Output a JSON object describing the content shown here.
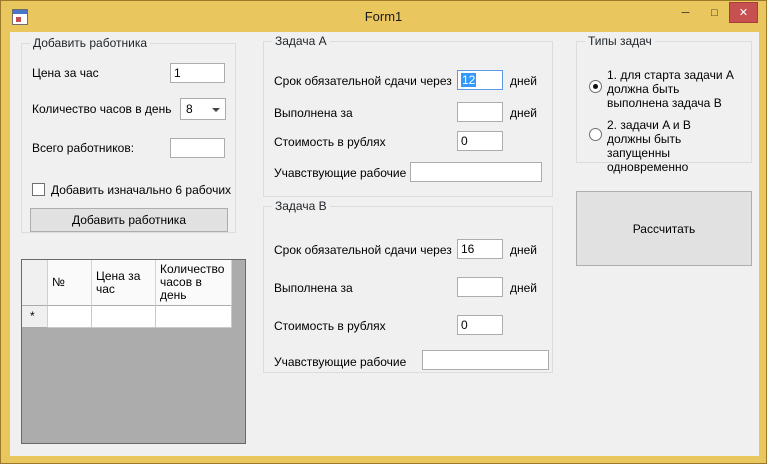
{
  "window": {
    "title": "Form1"
  },
  "titlebar": {
    "minimize_glyph": "─",
    "maximize_glyph": "□",
    "close_glyph": "✕"
  },
  "add_worker": {
    "title": "Добавить работника",
    "price_label": "Цена за час",
    "price_value": "1",
    "hours_label": "Количество часов в день",
    "hours_value": "8",
    "total_label": "Всего работников:",
    "total_value": "",
    "checkbox_label": "Добавить изначально 6 рабочих",
    "add_button_label": "Добавить работника"
  },
  "grid": {
    "columns": [
      "№",
      "Цена за час",
      "Количество часов в день"
    ],
    "new_row_marker": "*"
  },
  "task_a": {
    "title": "Задача A",
    "deadline_label": "Срок обязательной сдачи через",
    "deadline_value": "12",
    "deadline_unit": "дней",
    "done_label": "Выполнена за",
    "done_value": "",
    "done_unit": "дней",
    "cost_label": "Стоимость в рублях",
    "cost_value": "0",
    "workers_label": "Учавствующие рабочие",
    "workers_value": ""
  },
  "task_b": {
    "title": "Задача B",
    "deadline_label": "Срок обязательной сдачи через",
    "deadline_value": "16",
    "deadline_unit": "дней",
    "done_label": "Выполнена за",
    "done_value": "",
    "done_unit": "дней",
    "cost_label": "Стоимость в рублях",
    "cost_value": "0",
    "workers_label": "Учавствующие рабочие",
    "workers_value": ""
  },
  "task_types": {
    "title": "Типы задач",
    "option1_label": "1. для старта задачи A\nдолжна быть\nвыполнена задача B",
    "option2_label": "2. задачи A и B\nдолжны быть\nзапущенны одновременно"
  },
  "calculate": {
    "label": "Рассчитать"
  },
  "colors": {
    "frame": "#EAC65F",
    "close_red": "#C75050",
    "selection_blue": "#3399FF",
    "focus_border": "#569DE5"
  }
}
